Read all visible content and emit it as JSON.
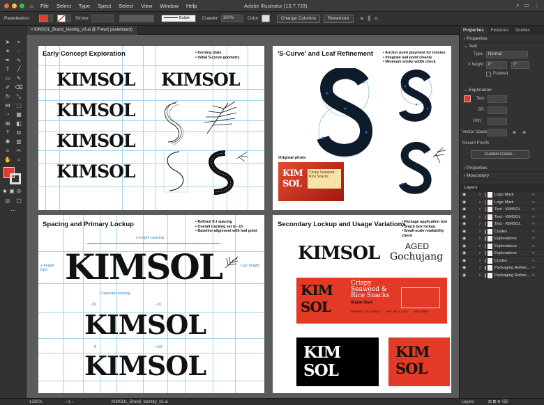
{
  "menubar": {
    "menus": [
      "File",
      "Select",
      "Type",
      "Spect",
      "Select",
      "View",
      "Window",
      "Help"
    ],
    "app_title": "Adobe Illustrator (13.7.7J3)"
  },
  "control": {
    "label": "Pasteleation",
    "stroke_label": "Stroke:",
    "stroke_width": "Balpie",
    "opacity_label": "Crawler:",
    "opacity": "100%",
    "color_label": "Color:",
    "btn_change": "Change Columns",
    "btn_rename": "Renemore",
    "fill_color": "#e53a2b"
  },
  "doc": {
    "tab": "KIMSOL_Brand_Identity_v3.ai @ Frew/( pasteboard)"
  },
  "boards": {
    "b1": {
      "title": "Early Concept Exploration",
      "notes": [
        "• Kerning trials",
        "• Initial S-curve geometry"
      ],
      "word": "KIMSOL"
    },
    "b2": {
      "title": "'S-Curve' and Leaf Refinement",
      "notes": [
        "• Anchor point playment for tension",
        "• Integrate leaf point cleanly",
        "• Minimum stroke width check"
      ],
      "photo_label": "Original photo",
      "photo_text1": "KIM",
      "photo_text2": "SOL",
      "photo_side": "Crispy Seaweed Rice Snacks"
    },
    "b3": {
      "title": "Spacing and Primary Lockup",
      "notes": [
        "• Refined K-I spacing",
        "• Overall tracking set to -15",
        "• Baseline alignment with leaf point"
      ],
      "word": "KIMSOL",
      "xheight_spacing": "x-height spacing",
      "xheight_light": "x-height light",
      "cap_height": "Cap height",
      "char_kerning": "Character kerning",
      "k1": "-20",
      "k2": "-10",
      "k3": "0",
      "k4": "+10"
    },
    "b4": {
      "title": "Secondary Lockup and Usage Variations",
      "notes": [
        "• Package application test",
        "• Snack box lockup",
        "• Small-scale readability check"
      ],
      "word": "KIMSOL",
      "aged": "AGED",
      "gochujang": "Gochujang",
      "pack_kim": "KIM",
      "pack_sol": "SOL",
      "pack_line1": "Crispy",
      "pack_line2": "Seaweed &",
      "pack_line3": "Rice Snacks",
      "pack_sub": "Bugak Style",
      "pack_small": "PRODUCT OF KOREA",
      "pack_small2": "NET WT. 1.7 OZ",
      "pack_small3": "MSG FREE"
    }
  },
  "panel": {
    "tabs": [
      "Properties",
      "Features",
      "Guides"
    ],
    "sections": {
      "properties": "Properties",
      "text": "Text",
      "type_label": "Type:",
      "type_value": "Normal",
      "xheight_label": "X height:",
      "xheight_v1": "0°",
      "xheight_v2": "0°",
      "framed": "Prabred",
      "exploration": "Exploration",
      "fill_label": "Text:",
      "sr_label": "SR:",
      "kith_label": "Kith:",
      "vector_label": "Vector Spack:",
      "recent_label": "Recent Proofs",
      "custom_btn": "Custom Colors...",
      "properties2": "Properties",
      "mascotery": "Moscrotery",
      "layers_title": "Layers"
    },
    "layers": [
      {
        "name": "Logo Mark",
        "color": "#e53a2b"
      },
      {
        "name": "Logo Mark",
        "color": "#e53a2b"
      },
      {
        "name": "Text - KIMSOL",
        "color": "#e53a2b"
      },
      {
        "name": "Text - KIMSOL",
        "color": "#e53a2b"
      },
      {
        "name": "Text - KIMSOL",
        "color": "#e53a2b"
      },
      {
        "name": "Cuides",
        "color": "#d06bd1"
      },
      {
        "name": "Explorations",
        "color": "#d06bd1"
      },
      {
        "name": "Explorations",
        "color": "#3e79d6"
      },
      {
        "name": "Explorations",
        "color": "#3e79d6"
      },
      {
        "name": "Cuides",
        "color": "#3e79d6"
      },
      {
        "name": "Packaging Refere...",
        "color": "#e58a2b"
      },
      {
        "name": "Packaging Refere...",
        "color": "#e58a2b"
      }
    ]
  },
  "status": {
    "zoom": "1230%",
    "file": "KIMSOL_Brand_Identity_v3.ai",
    "layers_footer": "Layers"
  }
}
